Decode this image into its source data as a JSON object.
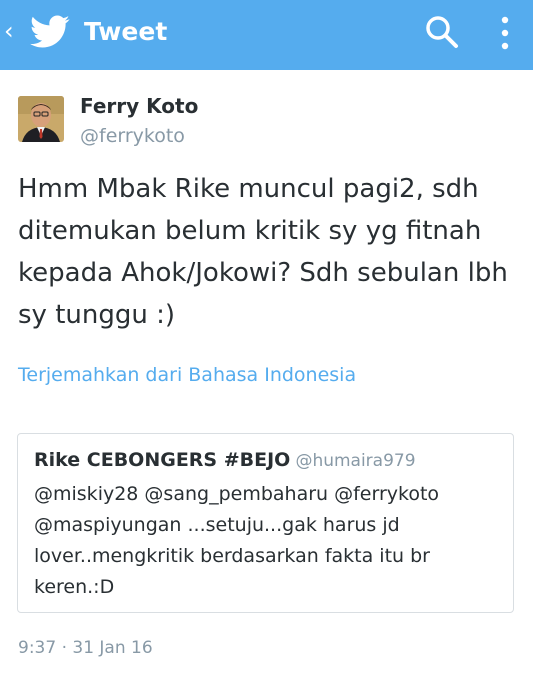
{
  "appbar": {
    "title": "Tweet",
    "back_glyph": "‹",
    "background_color": "#55acee",
    "icons": [
      "chevron-left-icon",
      "twitter-bird-icon",
      "search-icon",
      "more-vertical-icon"
    ]
  },
  "author": {
    "name": "Ferry Koto",
    "handle": "@ferrykoto"
  },
  "tweet": {
    "text": "Hmm Mbak Rike muncul pagi2, sdh ditemukan belum kritik sy yg fitnah kepada Ahok/Jokowi? Sdh sebulan lbh sy tunggu :)",
    "translate_label": "Terjemahkan dari Bahasa Indonesia",
    "timestamp": "9:37 · 31 Jan 16"
  },
  "quoted_tweet": {
    "name": "Rike CEBONGERS #BEJO",
    "handle": "@humaira979",
    "text": "@miskiy28 @sang_pembaharu @ferrykoto @maspiyungan ...setuju...gak harus jd lover..mengkritik berdasarkan fakta itu br keren.:D"
  },
  "colors": {
    "link": "#55acee",
    "text": "#292f33",
    "secondary_text": "#8899a6"
  }
}
